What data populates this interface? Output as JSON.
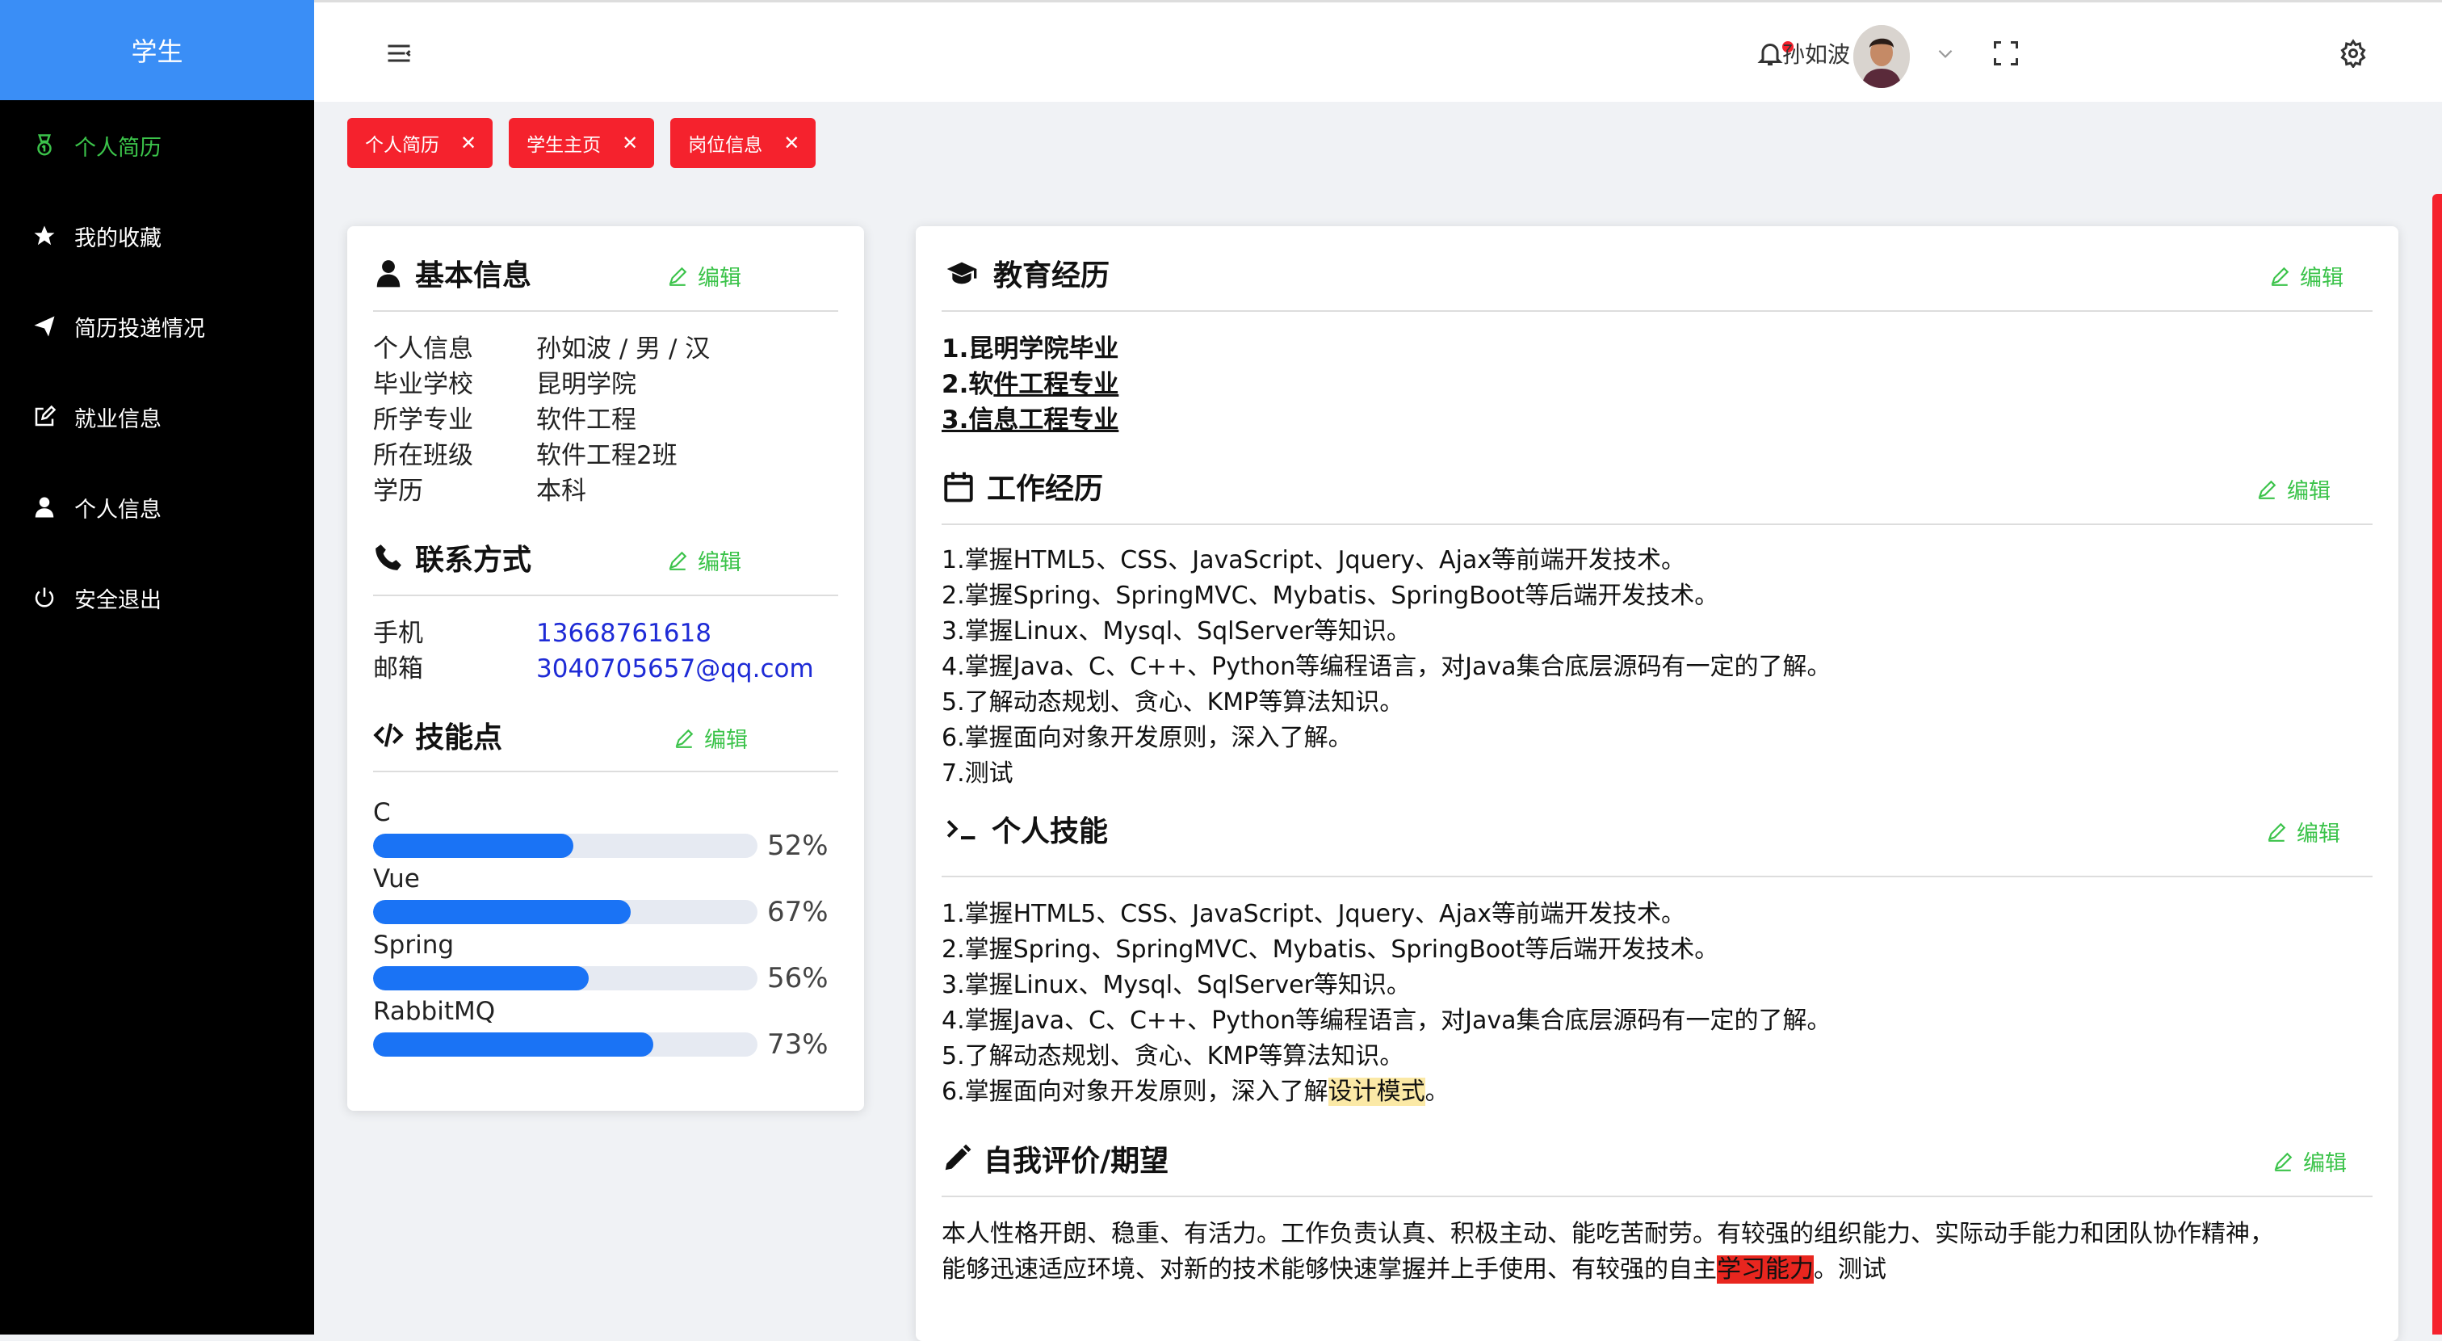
{
  "sidebar": {
    "title": "学生",
    "items": [
      {
        "label": "个人简历",
        "icon": "medal-icon",
        "active": true
      },
      {
        "label": "我的收藏",
        "icon": "star-icon"
      },
      {
        "label": "简历投递情况",
        "icon": "send-icon"
      },
      {
        "label": "就业信息",
        "icon": "edit-square-icon"
      },
      {
        "label": "个人信息",
        "icon": "user-icon"
      },
      {
        "label": "安全退出",
        "icon": "power-icon"
      }
    ]
  },
  "header": {
    "username": "孙如波",
    "icons": [
      "menu-fold-icon",
      "bell-icon",
      "loading-icon",
      "fullscreen-icon",
      "chevron-down-icon",
      "settings-icon"
    ]
  },
  "tabs": [
    {
      "label": "个人简历"
    },
    {
      "label": "学生主页"
    },
    {
      "label": "岗位信息"
    }
  ],
  "basic_info": {
    "title": "基本信息",
    "edit_label": "编辑",
    "rows": [
      {
        "key": "个人信息",
        "value": "孙如波 / 男 / 汉"
      },
      {
        "key": "毕业学校",
        "value": "昆明学院"
      },
      {
        "key": "所学专业",
        "value": "软件工程"
      },
      {
        "key": "所在班级",
        "value": "软件工程2班"
      },
      {
        "key": "学历",
        "value": "本科"
      }
    ]
  },
  "contact": {
    "title": "联系方式",
    "edit_label": "编辑",
    "rows": [
      {
        "key": "手机",
        "value": "13668761618"
      },
      {
        "key": "邮箱",
        "value": "3040705657@qq.com"
      }
    ]
  },
  "skills": {
    "title": "技能点",
    "edit_label": "编辑",
    "items": [
      {
        "name": "C",
        "percent": 52,
        "percent_label": "52%"
      },
      {
        "name": "Vue",
        "percent": 67,
        "percent_label": "67%"
      },
      {
        "name": "Spring",
        "percent": 56,
        "percent_label": "56%"
      },
      {
        "name": "RabbitMQ",
        "percent": 73,
        "percent_label": "73%"
      }
    ]
  },
  "education": {
    "title": "教育经历",
    "edit_label": "编辑",
    "lines": {
      "l1": "1.昆明学院毕业",
      "l2_prefix": "2.软",
      "l2_ul": "件工程专业",
      "l3": "3.信息工程专业"
    }
  },
  "work": {
    "title": "工作经历",
    "edit_label": "编辑",
    "lines": [
      "1.掌握HTML5、CSS、JavaScript、Jquery、Ajax等前端开发技术。",
      "2.掌握Spring、SpringMVC、Mybatis、SpringBoot等后端开发技术。",
      "3.掌握Linux、Mysql、SqlServer等知识。",
      "4.掌握Java、C、C++、Python等编程语言，对Java集合底层源码有一定的了解。",
      "5.了解动态规划、贪心、KMP等算法知识。",
      "6.掌握面向对象开发原则，深入了解。",
      "7.测试"
    ]
  },
  "personal_skills": {
    "title": "个人技能",
    "edit_label": "编辑",
    "lines": [
      "1.掌握HTML5、CSS、JavaScript、Jquery、Ajax等前端开发技术。",
      "2.掌握Spring、SpringMVC、Mybatis、SpringBoot等后端开发技术。",
      "3.掌握Linux、Mysql、SqlServer等知识。",
      "4.掌握Java、C、C++、Python等编程语言，对Java集合底层源码有一定的了解。",
      "5.了解动态规划、贪心、KMP等算法知识。"
    ],
    "last_line_prefix": "6.掌握面向对象开发原则，深入了解",
    "last_line_highlight": "设计模式",
    "last_line_suffix": "。"
  },
  "self_eval": {
    "title": "自我评价/期望",
    "edit_label": "编辑",
    "line1": "本人性格开朗、稳重、有活力。工作负责认真、积极主动、能吃苦耐劳。有较强的组织能力、实际动手能力和团队协作精神，",
    "line2_prefix": "能够迅速适应环境、对新的技术能够快速掌握并上手使用、有较强的自主",
    "line2_highlight": "学习能力",
    "line2_suffix": "。测试"
  },
  "colors": {
    "brand": "#3a8ef6",
    "active_menu": "#3bc34a",
    "tag": "#f5222d",
    "edit": "#3bc34a",
    "progress": "#1a73f5",
    "link": "#1e2bd6"
  }
}
